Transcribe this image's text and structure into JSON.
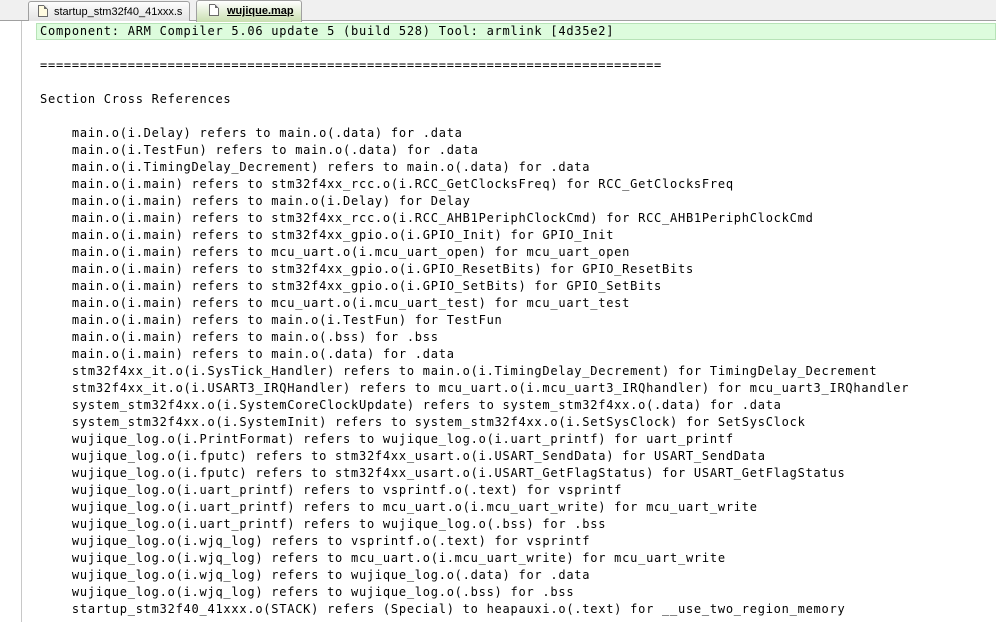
{
  "tabs": [
    {
      "label": "startup_stm32f40_41xxx.s",
      "active": false,
      "icon": "document-icon"
    },
    {
      "label": "wujique.map",
      "active": true,
      "icon": "document-icon"
    }
  ],
  "editor": {
    "current_line": 0,
    "lines": [
      "Component: ARM Compiler 5.06 update 5 (build 528) Tool: armlink [4d35e2]",
      "",
      "==============================================================================",
      "",
      "Section Cross References",
      "",
      "    main.o(i.Delay) refers to main.o(.data) for .data",
      "    main.o(i.TestFun) refers to main.o(.data) for .data",
      "    main.o(i.TimingDelay_Decrement) refers to main.o(.data) for .data",
      "    main.o(i.main) refers to stm32f4xx_rcc.o(i.RCC_GetClocksFreq) for RCC_GetClocksFreq",
      "    main.o(i.main) refers to main.o(i.Delay) for Delay",
      "    main.o(i.main) refers to stm32f4xx_rcc.o(i.RCC_AHB1PeriphClockCmd) for RCC_AHB1PeriphClockCmd",
      "    main.o(i.main) refers to stm32f4xx_gpio.o(i.GPIO_Init) for GPIO_Init",
      "    main.o(i.main) refers to mcu_uart.o(i.mcu_uart_open) for mcu_uart_open",
      "    main.o(i.main) refers to stm32f4xx_gpio.o(i.GPIO_ResetBits) for GPIO_ResetBits",
      "    main.o(i.main) refers to stm32f4xx_gpio.o(i.GPIO_SetBits) for GPIO_SetBits",
      "    main.o(i.main) refers to mcu_uart.o(i.mcu_uart_test) for mcu_uart_test",
      "    main.o(i.main) refers to main.o(i.TestFun) for TestFun",
      "    main.o(i.main) refers to main.o(.bss) for .bss",
      "    main.o(i.main) refers to main.o(.data) for .data",
      "    stm32f4xx_it.o(i.SysTick_Handler) refers to main.o(i.TimingDelay_Decrement) for TimingDelay_Decrement",
      "    stm32f4xx_it.o(i.USART3_IRQHandler) refers to mcu_uart.o(i.mcu_uart3_IRQhandler) for mcu_uart3_IRQhandler",
      "    system_stm32f4xx.o(i.SystemCoreClockUpdate) refers to system_stm32f4xx.o(.data) for .data",
      "    system_stm32f4xx.o(i.SystemInit) refers to system_stm32f4xx.o(i.SetSysClock) for SetSysClock",
      "    wujique_log.o(i.PrintFormat) refers to wujique_log.o(i.uart_printf) for uart_printf",
      "    wujique_log.o(i.fputc) refers to stm32f4xx_usart.o(i.USART_SendData) for USART_SendData",
      "    wujique_log.o(i.fputc) refers to stm32f4xx_usart.o(i.USART_GetFlagStatus) for USART_GetFlagStatus",
      "    wujique_log.o(i.uart_printf) refers to vsprintf.o(.text) for vsprintf",
      "    wujique_log.o(i.uart_printf) refers to mcu_uart.o(i.mcu_uart_write) for mcu_uart_write",
      "    wujique_log.o(i.uart_printf) refers to wujique_log.o(.bss) for .bss",
      "    wujique_log.o(i.wjq_log) refers to vsprintf.o(.text) for vsprintf",
      "    wujique_log.o(i.wjq_log) refers to mcu_uart.o(i.mcu_uart_write) for mcu_uart_write",
      "    wujique_log.o(i.wjq_log) refers to wujique_log.o(.data) for .data",
      "    wujique_log.o(i.wjq_log) refers to wujique_log.o(.bss) for .bss",
      "    startup_stm32f40_41xxx.o(STACK) refers (Special) to heapauxi.o(.text) for __use_two_region_memory"
    ]
  }
}
